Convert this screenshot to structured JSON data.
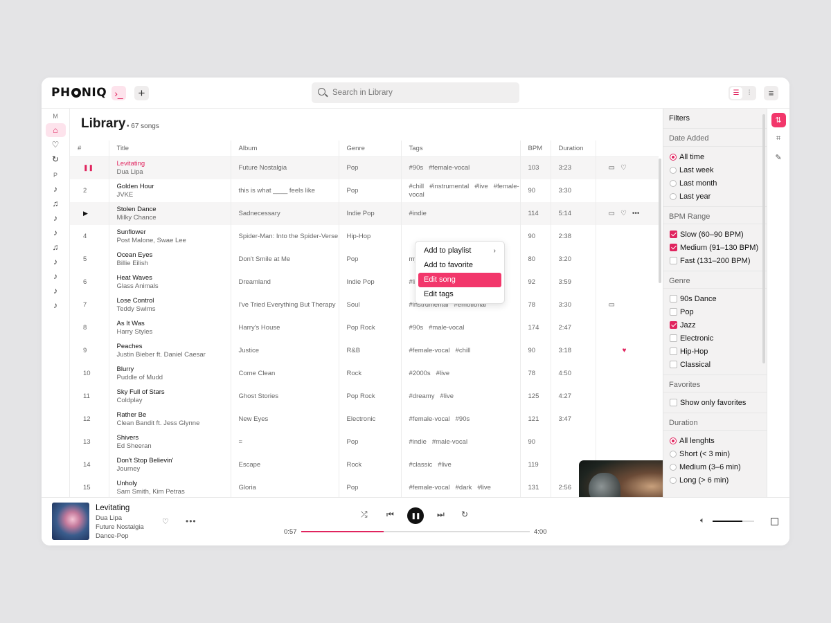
{
  "app": {
    "logo": "PHONIQ"
  },
  "search": {
    "placeholder": "Search in Library"
  },
  "rail": {
    "section_m": "M",
    "section_p": "P",
    "m_icons": [
      "home-icon",
      "heart-icon",
      "refresh-icon"
    ],
    "p_icons": [
      "note-icon",
      "notes-icon",
      "note-icon",
      "note-icon",
      "notes-icon",
      "note-icon",
      "note-icon",
      "note-icon",
      "note-icon"
    ]
  },
  "library": {
    "title": "Library",
    "count": "67 songs",
    "columns": [
      "#",
      "Title",
      "Album",
      "Genre",
      "Tags",
      "BPM",
      "Duration"
    ],
    "rows": [
      {
        "num": "",
        "title": "Levitating",
        "artist": "Dua Lipa",
        "album": "Future Nostalgia",
        "genre": "Pop",
        "tags": [
          "#90s",
          "#female-vocal"
        ],
        "bpm": "103",
        "duration": "3:23",
        "state": "playing"
      },
      {
        "num": "2",
        "title": "Golden Hour",
        "artist": "JVKE",
        "album": "this is what ____ feels like",
        "genre": "Pop",
        "tags": [
          "#chill",
          "#instrumental",
          "#live",
          "#female-vocal"
        ],
        "bpm": "90",
        "duration": "3:30"
      },
      {
        "num": "",
        "title": "Stolen Dance",
        "artist": "Milky Chance",
        "album": "Sadnecessary",
        "genre": "Indie Pop",
        "tags": [
          "#indie"
        ],
        "bpm": "114",
        "duration": "5:14",
        "state": "hover"
      },
      {
        "num": "4",
        "title": "Sunflower",
        "artist": "Post Malone, Swae Lee",
        "album": "Spider-Man: Into the Spider-Verse",
        "genre": "Hip-Hop",
        "tags": [],
        "bpm": "90",
        "duration": "2:38"
      },
      {
        "num": "5",
        "title": "Ocean Eyes",
        "artist": "Billie Eilish",
        "album": "Don't Smile at Me",
        "genre": "Pop",
        "tags": [
          "my"
        ],
        "bpm": "80",
        "duration": "3:20"
      },
      {
        "num": "6",
        "title": "Heat Waves",
        "artist": "Glass Animals",
        "album": "Dreamland",
        "genre": "Indie Pop",
        "tags": [
          "#live",
          "#indie"
        ],
        "bpm": "92",
        "duration": "3:59"
      },
      {
        "num": "7",
        "title": "Lose Control",
        "artist": "Teddy Swims",
        "album": "I've Tried Everything But Therapy",
        "genre": "Soul",
        "tags": [
          "#instrumental",
          "#emotional"
        ],
        "bpm": "78",
        "duration": "3:30"
      },
      {
        "num": "8",
        "title": "As It Was",
        "artist": "Harry Styles",
        "album": "Harry's House",
        "genre": "Pop Rock",
        "tags": [
          "#90s",
          "#male-vocal"
        ],
        "bpm": "174",
        "duration": "2:47"
      },
      {
        "num": "9",
        "title": "Peaches",
        "artist": "Justin Bieber ft. Daniel Caesar",
        "album": "Justice",
        "genre": "R&B",
        "tags": [
          "#female-vocal",
          "#chill"
        ],
        "bpm": "90",
        "duration": "3:18"
      },
      {
        "num": "10",
        "title": "Blurry",
        "artist": "Puddle of Mudd",
        "album": "Come Clean",
        "genre": "Rock",
        "tags": [
          "#2000s",
          "#live"
        ],
        "bpm": "78",
        "duration": "4:50"
      },
      {
        "num": "11",
        "title": "Sky Full of Stars",
        "artist": "Coldplay",
        "album": "Ghost Stories",
        "genre": "Pop Rock",
        "tags": [
          "#dreamy",
          "#live"
        ],
        "bpm": "125",
        "duration": "4:27"
      },
      {
        "num": "12",
        "title": "Rather Be",
        "artist": "Clean Bandit ft. Jess Glynne",
        "album": "New Eyes",
        "genre": "Electronic",
        "tags": [
          "#female-vocal",
          "#90s"
        ],
        "bpm": "121",
        "duration": "3:47"
      },
      {
        "num": "13",
        "title": "Shivers",
        "artist": "Ed Sheeran",
        "album": "=",
        "genre": "Pop",
        "tags": [
          "#indie",
          "#male-vocal"
        ],
        "bpm": "90",
        "duration": ""
      },
      {
        "num": "14",
        "title": "Don't Stop Believin'",
        "artist": "Journey",
        "album": "Escape",
        "genre": "Rock",
        "tags": [
          "#classic",
          "#live"
        ],
        "bpm": "119",
        "duration": ""
      },
      {
        "num": "15",
        "title": "Unholy",
        "artist": "Sam Smith, Kim Petras",
        "album": "Gloria",
        "genre": "Pop",
        "tags": [
          "#female-vocal",
          "#dark",
          "#live"
        ],
        "bpm": "131",
        "duration": "2:56"
      }
    ]
  },
  "context_menu": {
    "items": [
      "Add to playlist",
      "Add to favorite",
      "Edit song",
      "Edit tags"
    ],
    "selected_index": 2
  },
  "filters": {
    "title": "Filters",
    "date_added": {
      "label": "Date Added",
      "options": [
        "All time",
        "Last week",
        "Last month",
        "Last year"
      ],
      "selected": 0
    },
    "bpm_range": {
      "label": "BPM Range",
      "options": [
        "Slow (60–90 BPM)",
        "Medium (91–130 BPM)",
        "Fast (131–200 BPM)"
      ],
      "checked": [
        true,
        true,
        false
      ]
    },
    "genre": {
      "label": "Genre",
      "options": [
        "90s Dance",
        "Pop",
        "Jazz",
        "Electronic",
        "Hip-Hop",
        "Classical"
      ],
      "checked": [
        false,
        false,
        true,
        false,
        false,
        false
      ]
    },
    "favorites": {
      "label": "Favorites",
      "options": [
        "Show only favorites"
      ],
      "checked": [
        false
      ]
    },
    "duration": {
      "label": "Duration",
      "options": [
        "All lenghts",
        "Short (< 3 min)",
        "Medium (3–6 min)",
        "Long (> 6 min)"
      ],
      "selected": 0
    }
  },
  "player": {
    "title": "Levitating",
    "artist": "Dua Lipa",
    "album": "Future Nostalgia",
    "genre": "Dance-Pop",
    "current_time": "0:57",
    "total_time": "4:00",
    "progress": 0.36,
    "volume": 0.72
  },
  "colors": {
    "accent": "#e0245e",
    "accent_light": "#fde3ec",
    "selected_menu": "#f2376b"
  }
}
